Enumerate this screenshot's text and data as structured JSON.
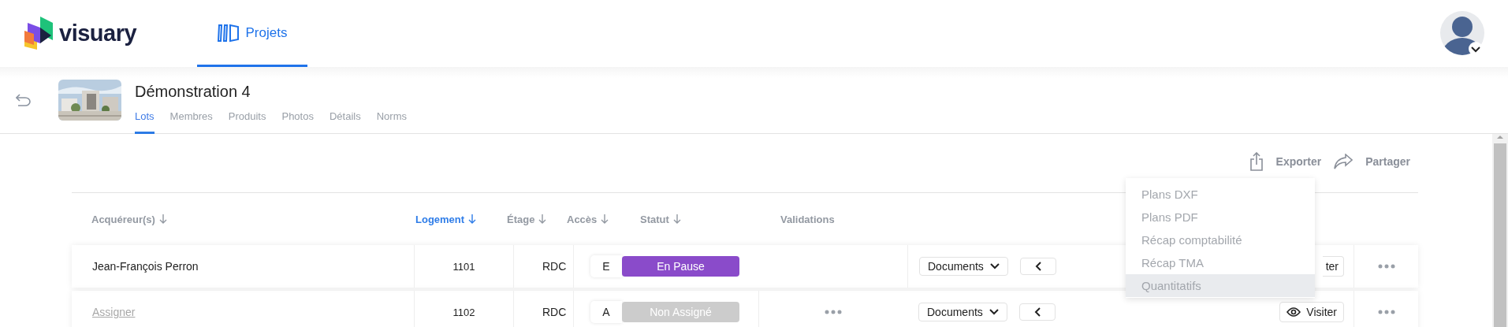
{
  "header": {
    "logo": "visuary",
    "nav": [
      {
        "label": "Projets",
        "selected": true
      }
    ]
  },
  "project": {
    "title": "Démonstration 4",
    "tabs": [
      {
        "label": "Lots",
        "selected": true
      },
      {
        "label": "Membres",
        "selected": false
      },
      {
        "label": "Produits",
        "selected": false
      },
      {
        "label": "Photos",
        "selected": false
      },
      {
        "label": "Détails",
        "selected": false
      },
      {
        "label": "Norms",
        "selected": false
      }
    ]
  },
  "toolbar": {
    "actions": [
      {
        "label": "Exporter",
        "kind": "export"
      },
      {
        "label": "Partager",
        "kind": "share"
      }
    ]
  },
  "export_menu": {
    "items": [
      {
        "label": "Plans DXF",
        "hovered": false
      },
      {
        "label": "Plans PDF",
        "hovered": false
      },
      {
        "label": "Récap comptabilité",
        "hovered": false
      },
      {
        "label": "Récap TMA",
        "hovered": false
      },
      {
        "label": "Quantitatifs",
        "hovered": true
      }
    ]
  },
  "table": {
    "columns": [
      {
        "label": "Acquéreur(s)",
        "active": false,
        "sortable": true
      },
      {
        "label": "Logement",
        "active": true,
        "sortable": true
      },
      {
        "label": "Étage",
        "active": false,
        "sortable": true
      },
      {
        "label": "Accès",
        "active": false,
        "sortable": true
      },
      {
        "label": "Statut",
        "active": false,
        "sortable": true
      },
      {
        "label": "Validations",
        "active": false,
        "sortable": false
      }
    ],
    "rows": [
      {
        "buyer": "Jean-François Perron",
        "assigned": true,
        "logement": "1101",
        "etage": "RDC",
        "acces": "E",
        "status": {
          "label": "En Pause",
          "color": "#8a4bca"
        },
        "validations": false,
        "documents": "Documents",
        "visit": {
          "label": "ter",
          "icon": false
        }
      },
      {
        "buyer": "Assigner",
        "assigned": false,
        "logement": "1102",
        "etage": "RDC",
        "acces": "A",
        "status": {
          "label": "Non Assigné",
          "color": "#cccccc"
        },
        "validations": true,
        "documents": "Documents",
        "visit": {
          "label": "Visiter",
          "icon": true
        }
      }
    ]
  }
}
